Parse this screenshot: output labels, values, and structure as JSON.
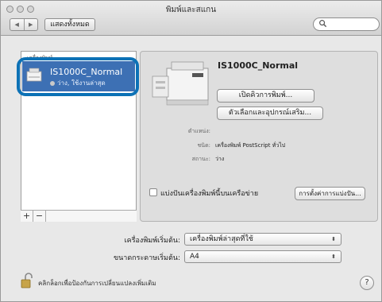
{
  "window": {
    "title": "พิมพ์และสแกน"
  },
  "toolbar": {
    "back_glyph": "◀",
    "forward_glyph": "▶",
    "show_all_label": "แสดงทั้งหมด",
    "search_placeholder": ""
  },
  "printer_list": {
    "header": "เครื่องพิมพ์",
    "items": [
      {
        "name": "IS1000C_Normal",
        "status": "ว่าง, ใช้งานล่าสุด",
        "selected": true
      }
    ],
    "add_label": "+",
    "remove_label": "−"
  },
  "detail": {
    "name": "IS1000C_Normal",
    "open_queue_label": "เปิดคิวการพิมพ์...",
    "options_supplies_label": "ตัวเลือกและอุปกรณ์เสริม...",
    "location_label": "ตำแหน่ง:",
    "location_value": "",
    "kind_label": "ชนิด:",
    "kind_value": "เครื่องพิมพ์ PostScript ทั่วไป",
    "status_label": "สถานะ:",
    "status_value": "ว่าง",
    "share_label": "แบ่งปันเครื่องพิมพ์นี้บนเครือข่าย",
    "share_checked": false,
    "sharing_prefs_label": "การตั้งค่าการแบ่งปัน..."
  },
  "defaults": {
    "default_printer_label": "เครื่องพิมพ์เริ่มต้น:",
    "default_printer_value": "เครื่องพิมพ์ล่าสุดที่ใช้",
    "default_paper_label": "ขนาดกระดาษเริ่มต้น:",
    "default_paper_value": "A4",
    "popup_arrows": "⬍"
  },
  "footer": {
    "lock_text": "คลิกล็อกเพื่อป้องกันการเปลี่ยนแปลงเพิ่มเติม",
    "help_label": "?"
  },
  "colors": {
    "selection": "#3d70b4",
    "highlight_ring": "#0d72b6"
  }
}
